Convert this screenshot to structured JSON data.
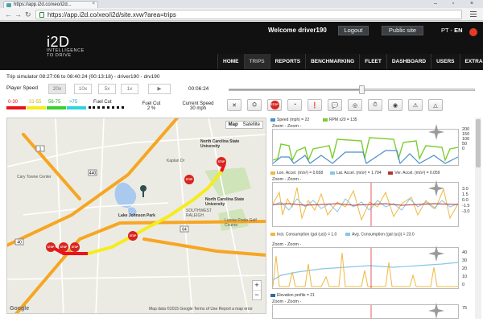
{
  "browser": {
    "tab_title": "https://app.i2d.co/xeo/i2d...",
    "url": "https://app.i2d.co/xeo/i2d/site.xvw?area=trips"
  },
  "header": {
    "logo_big": "i2D",
    "logo_line1": "INTELLIGENCE",
    "logo_line2": "TO DRIVE",
    "welcome": "Welcome driver190",
    "logout": "Logout",
    "public_site": "Public site",
    "lang_pt": "PT",
    "lang_sep": " - ",
    "lang_en": "EN",
    "nav": [
      "HOME",
      "TRIPS",
      "REPORTS",
      "BENCHMARKING",
      "FLEET",
      "DASHBOARD",
      "USERS",
      "EXTRAS"
    ]
  },
  "simulator": {
    "title": "Trip simulator 08:27:06 to 08:40:24 (00:13:18) - driver190 - drv190",
    "player_speed_label": "Player Speed",
    "speeds": [
      "20x",
      "10x",
      "5x",
      "1x"
    ],
    "play_icon": "▶",
    "elapsed": "00:06:24",
    "progress": 0.54
  },
  "legend": {
    "ranges": [
      "0-30",
      "31-55",
      "56-75",
      ">75"
    ],
    "colors": [
      "#e8141c",
      "#f4ec1c",
      "#36d12a",
      "#2fd4e0"
    ],
    "fuel_cut": "Fuel Cut",
    "fuel_cut_title": "Fuel Cut",
    "fuel_cut_value": "2 %",
    "current_speed_title": "Current Speed",
    "current_speed_value": "30 mph"
  },
  "toolbar": {
    "icons": [
      "close-icon",
      "fleet-icon",
      "stop-sign-icon",
      "speedometer-icon",
      "warning-circle-icon",
      "comment-icon",
      "target-icon",
      "timer-icon",
      "brake-icon",
      "alert-triangle-icon",
      "warning-triangle-icon"
    ],
    "stop_text": "STOP"
  },
  "map": {
    "type_map": "Map",
    "type_satellite": "Satellite",
    "zoom_in": "+",
    "zoom_out": "−",
    "google": "Google",
    "footer": "Map data ©2015 Google    Terms of Use    Report a map error",
    "labels": {
      "cary_towne": "Cary Towne Center",
      "ncsu": "North Carolina State University",
      "ncsu2": "North Carolina State University",
      "lake_johnson": "Lake Johnson Park",
      "lonnie_poole": "Lonnie Poole Golf Course",
      "sw_raleigh": "SOUTHWEST RALEIGH",
      "kaplan": "Kaplan Dr"
    },
    "stop_text": "STOP",
    "route_num_64": "64",
    "route_num_440": "440",
    "route_num_40": "40",
    "route_num_1": "1"
  },
  "charts": {
    "zoom_label": "Zoom - Zoom -",
    "panels": [
      {
        "legend": [
          {
            "name": "Speed (mph) = 22",
            "color": "#4a90c8"
          },
          {
            "name": "RPM x20 = 135",
            "color": "#7ccd31"
          }
        ],
        "yticks": [
          "200",
          "150",
          "100",
          "50",
          "0"
        ]
      },
      {
        "legend": [
          {
            "name": "Lon. Accel. (m/s²) = 0.658",
            "color": "#f0b840"
          },
          {
            "name": "Lat. Accel. (m/s²) = 1.794",
            "color": "#88c6e8"
          },
          {
            "name": "Ver. Accel. (m/s²) = 0.059",
            "color": "#b83232"
          }
        ],
        "yticks": [
          "3.0",
          "1.5",
          "0.0",
          "-1.5",
          "-3.0"
        ]
      },
      {
        "legend": [
          {
            "name": "Inst. Consumption (gal (us)) = 1.0",
            "color": "#f0b840"
          },
          {
            "name": "Avg. Consumption (gal (us)) = 23.0",
            "color": "#88c6e8"
          }
        ],
        "yticks": [
          "40",
          "30",
          "20",
          "10",
          "0"
        ]
      },
      {
        "legend": [
          {
            "name": "Elevation profile = 21",
            "color": "#2e6aa6"
          }
        ],
        "yticks": [
          "75"
        ]
      }
    ]
  }
}
